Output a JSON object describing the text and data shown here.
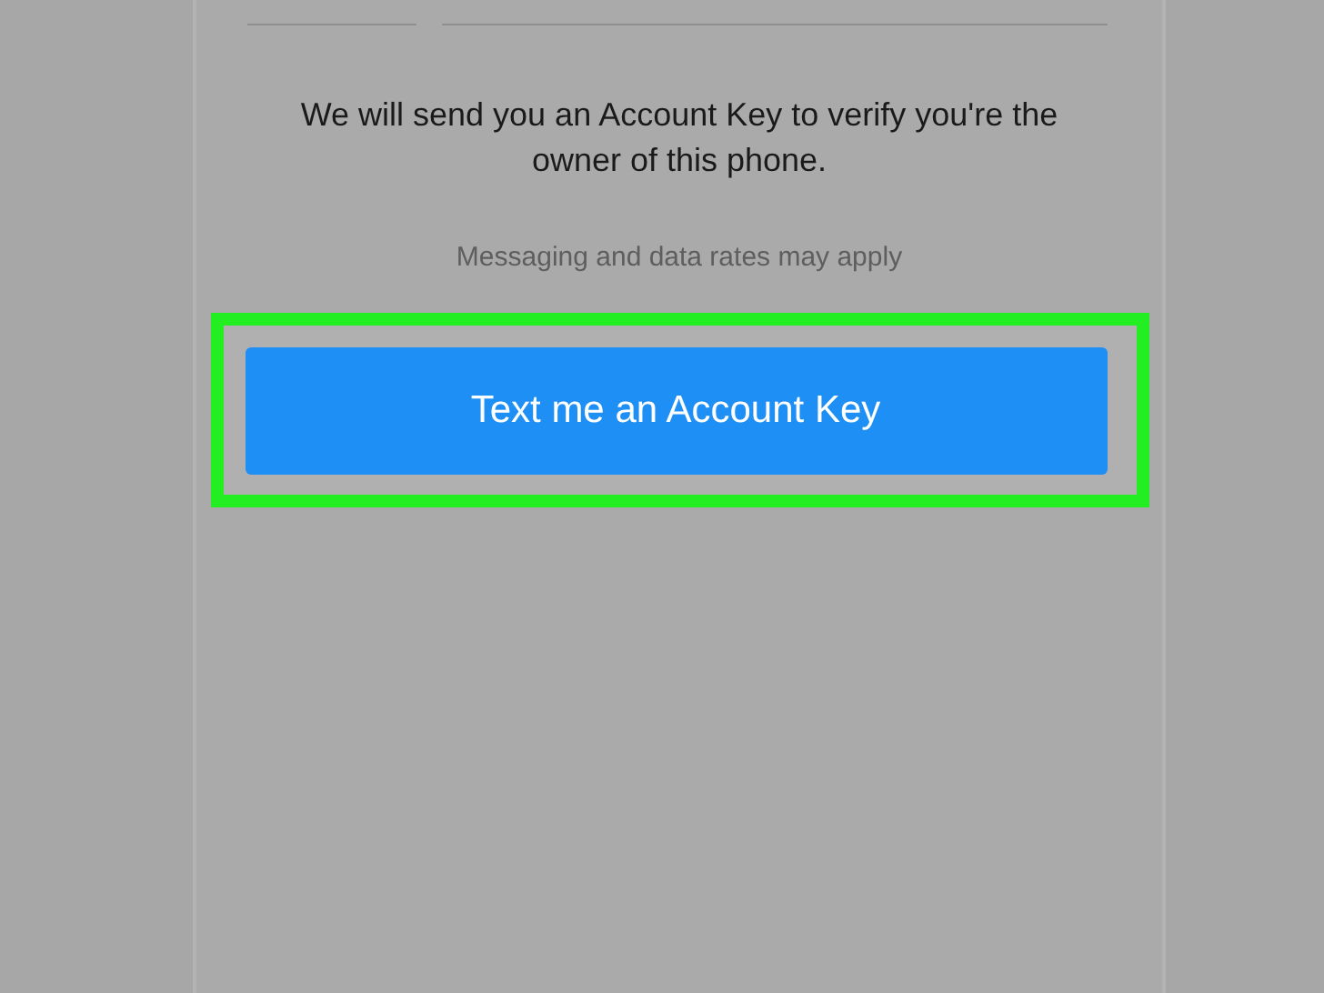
{
  "message": "We will send you an Account Key to verify you're the owner of this phone.",
  "note": "Messaging and data rates may apply",
  "button": {
    "label": "Text me an Account Key",
    "highlighted": true
  }
}
